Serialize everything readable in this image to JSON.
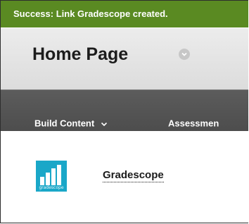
{
  "notification": {
    "text": "Success: Link Gradescope created."
  },
  "header": {
    "title": "Home Page",
    "title_menu_icon": "chevron-down-icon"
  },
  "toolbar": {
    "items": [
      {
        "label": "Build Content",
        "icon": "chevron-down-icon"
      },
      {
        "label": "Assessmen"
      }
    ]
  },
  "content": {
    "items": [
      {
        "title": "Gradescope",
        "icon": "gradescope-logo-icon",
        "logo_text": "gradescope"
      }
    ]
  },
  "colors": {
    "success_bar": "#5a8a22",
    "header_bg": "#e4e4e4",
    "toolbar_bg": "#555555",
    "logo_bg": "#1aa7c8"
  }
}
